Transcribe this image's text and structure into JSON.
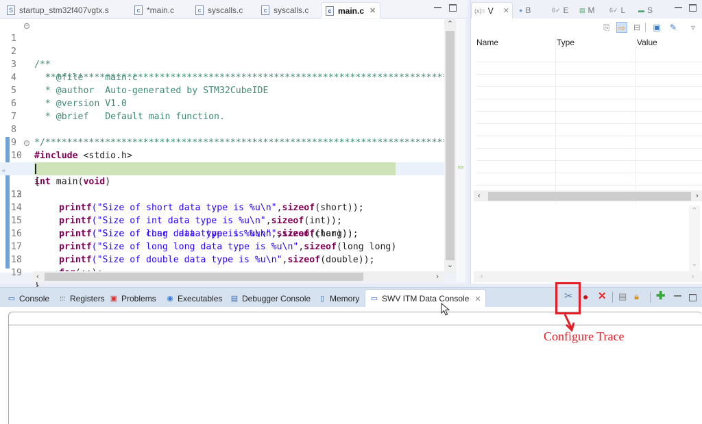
{
  "editor": {
    "tabs": [
      {
        "icon": "S",
        "label": "startup_stm32f407vgtx.s",
        "active": false
      },
      {
        "icon": "c",
        "label": "*main.c",
        "active": false
      },
      {
        "icon": "c",
        "label": "syscalls.c",
        "active": false
      },
      {
        "icon": "c",
        "label": "syscalls.c",
        "active": false
      },
      {
        "icon": "c",
        "label": "main.c",
        "active": true
      }
    ],
    "close_glyph": "✕",
    "lines": [
      {
        "n": "1",
        "text": "/**"
      },
      {
        "n": "2",
        "text": "  ******************************************************************************"
      },
      {
        "n": "3",
        "text": "  * @file    main.c"
      },
      {
        "n": "4",
        "text": "  * @author  Auto-generated by STM32CubeIDE"
      },
      {
        "n": "5",
        "text": "  * @version V1.0"
      },
      {
        "n": "6",
        "text": "  * @brief   Default main function."
      },
      {
        "n": "7",
        "text": "  ******************************************************************************"
      },
      {
        "n": "8",
        "text": "*/"
      },
      {
        "n": "9",
        "kw": "#include",
        "rest": " <stdio.h>"
      },
      {
        "n": "10",
        "kw": "int",
        "rest": " main(",
        "kw2": "void",
        "rest2": ")"
      },
      {
        "n": "11",
        "text": "{"
      },
      {
        "n": "12",
        "fn": "printf",
        "str": "(\"Size of char data type is %u\\n\"",
        "so": "sizeof",
        "tail": "(char));"
      },
      {
        "n": "13",
        "fn": "printf",
        "str": "(\"Size of short data type is %u\\n\"",
        "so": "sizeof",
        "tail": "(short));"
      },
      {
        "n": "14",
        "fn": "printf",
        "str": "(\"Size of int data type is %u\\n\"",
        "so": "sizeof",
        "tail": "(int));"
      },
      {
        "n": "15",
        "fn": "printf",
        "str": "(\"Size of long  data type is %u\\n\"",
        "so": "sizeof",
        "tail": "(long));"
      },
      {
        "n": "16",
        "fn": "printf",
        "str": "(\"Size of long long data type is %u\\n\"",
        "so": "sizeof",
        "tail": "(long long)"
      },
      {
        "n": "17",
        "fn": "printf",
        "str": "(\"Size of double data type is %u\\n\"",
        "so": "sizeof",
        "tail": "(double));"
      },
      {
        "n": "18",
        "kw": "for",
        "rest": "(;;);"
      },
      {
        "n": "19",
        "text": "}"
      }
    ],
    "current_line": "12"
  },
  "variables_view": {
    "tabs": [
      {
        "icon": "(x)=",
        "label": "V",
        "active": true
      },
      {
        "icon": "●",
        "label": "B",
        "active": false
      },
      {
        "icon": "6✓",
        "label": "E",
        "active": false
      },
      {
        "icon": "▤",
        "label": "M",
        "active": false
      },
      {
        "icon": "6✓",
        "label": "L",
        "active": false
      },
      {
        "icon": "▬",
        "label": "S",
        "active": false
      }
    ],
    "columns": [
      "Name",
      "Type",
      "Value"
    ],
    "rows": []
  },
  "console": {
    "tabs": [
      {
        "icon": "console",
        "label": "Console"
      },
      {
        "icon": "registers",
        "label": "Registers"
      },
      {
        "icon": "problems",
        "label": "Problems"
      },
      {
        "icon": "executables",
        "label": "Executables"
      },
      {
        "icon": "debugger-console",
        "label": "Debugger Console"
      },
      {
        "icon": "memory",
        "label": "Memory"
      },
      {
        "icon": "swv-console",
        "label": "SWV ITM Data Console",
        "active": true
      }
    ],
    "toolbar": [
      "configure-trace",
      "start-trace",
      "remove",
      "clear",
      "lock",
      "add-port",
      "minimize",
      "maximize"
    ]
  },
  "annotation": {
    "label": "Configure Trace",
    "color": "#e41e26"
  },
  "colors": {
    "comment": "#3f8a6f",
    "keyword": "#7f0055",
    "string": "#2a00ff",
    "current_line_highlight": "#cfe3b8"
  }
}
